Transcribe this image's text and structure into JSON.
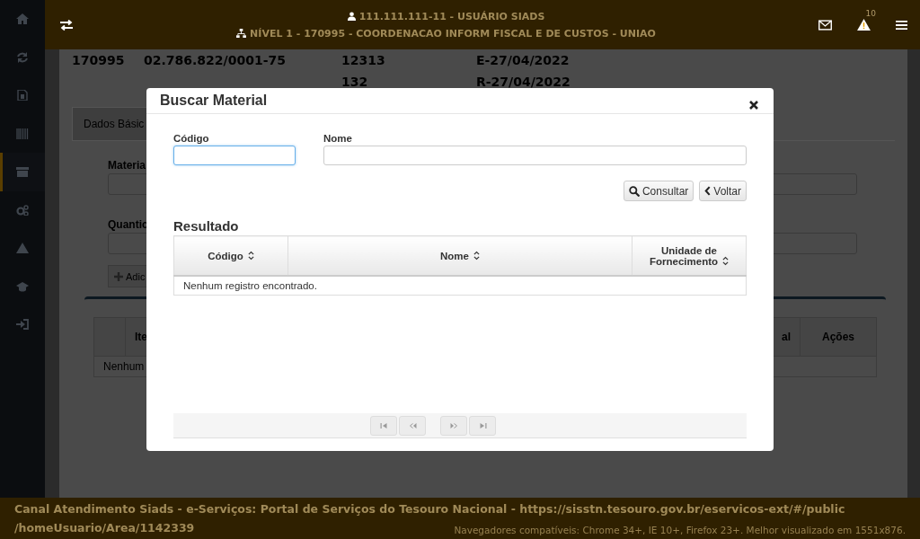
{
  "sidebar": {
    "items": [
      {
        "selected": false
      },
      {
        "selected": false
      },
      {
        "selected": false
      },
      {
        "selected": false
      },
      {
        "selected": true
      },
      {
        "selected": false
      },
      {
        "selected": false
      },
      {
        "selected": false
      },
      {
        "selected": false
      }
    ]
  },
  "header": {
    "user": "111.111.111-11 - USUÁRIO SIADS",
    "unit": "NÍVEL 1 - 170995 - COORDENACAO INFORM FISCAL E DE CUSTOS - UNIAO",
    "alert_count": "10"
  },
  "summary": {
    "row_1": [
      "170995",
      "02.786.822/0001-75",
      "12313",
      "E-27/04/2022"
    ],
    "row_2": [
      "132",
      "R-27/04/2022"
    ]
  },
  "background_form": {
    "tab": {
      "label": "Dados Básic",
      "selected": true
    },
    "labels": [
      "Materia",
      "Quantic"
    ],
    "add_button": "Adic",
    "table_columns": [
      "Ite",
      "al",
      "Ações"
    ],
    "empty_row": "Nenhum"
  },
  "modal": {
    "title": "Buscar Material",
    "fields": [
      {
        "label": "Código",
        "focused": true
      },
      {
        "label": "Nome",
        "focused": false
      }
    ],
    "buttons": [
      {
        "kind": "search",
        "label": "Consultar"
      },
      {
        "kind": "back",
        "label": "Voltar"
      }
    ],
    "results_title": "Resultado",
    "columns": [
      {
        "label": "Código"
      },
      {
        "label": "Nome"
      },
      {
        "label": "Unidade de Fornecimento"
      }
    ],
    "empty_message": "Nenhum registro encontrado.",
    "pager": [
      {
        "kind": "first",
        "disabled": true
      },
      {
        "kind": "prev",
        "disabled": true
      },
      {
        "kind": "next",
        "disabled": true
      },
      {
        "kind": "last",
        "disabled": true
      }
    ]
  },
  "footer": {
    "line_1": "Canal Atendimento Siads - e-Serviços: Portal de Serviços do Tesouro Nacional - https://sisstn.tesouro.gov.br/eservicos-ext/#/public",
    "line_2": "/homeUsuario/Area/1142339",
    "compat": "Navegadores compatíveis: Chrome 34+, IE 10+, Firefox 23+. Melhor visualizado em 1551x876."
  }
}
